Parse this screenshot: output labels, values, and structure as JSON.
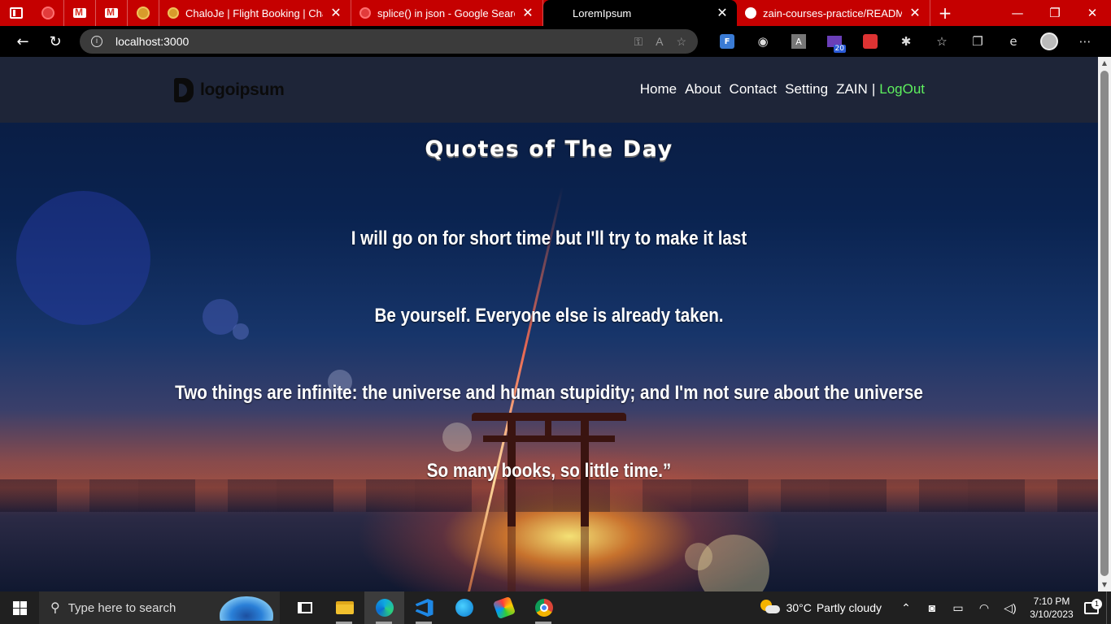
{
  "browser": {
    "tabs": [
      {
        "title": "ChaloJe | Flight Booking | ChaloJe"
      },
      {
        "title": "splice() in json - Google Search"
      },
      {
        "title": "LoremIpsum",
        "active": true
      },
      {
        "title": "zain-courses-practice/README.md"
      }
    ],
    "url": "localhost:3000",
    "extension_badge": "20",
    "extension_letter_f": "F",
    "extension_letter_a": "A"
  },
  "site": {
    "logo_text": "logoipsum",
    "nav": {
      "home": "Home",
      "about": "About",
      "contact": "Contact",
      "setting": "Setting",
      "user": "ZAIN",
      "separator": "|",
      "logout": "LogOut"
    },
    "heading": "Quotes of The Day",
    "quotes": [
      "I will go on for short time but I'll try to make it last",
      "Be yourself. Everyone else is already taken.",
      "Two things are infinite: the universe and human stupidity; and I'm not sure about the universe",
      "So many books, so little time.”"
    ]
  },
  "colors": {
    "tabstrip": "#c50000",
    "nav_bg": "#1e2538",
    "logout": "#5ef05e"
  },
  "taskbar": {
    "search_placeholder": "Type here to search",
    "temperature": "30°C",
    "condition": "Partly cloudy",
    "time": "7:10 PM",
    "date": "3/10/2023",
    "notification_count": "1"
  }
}
